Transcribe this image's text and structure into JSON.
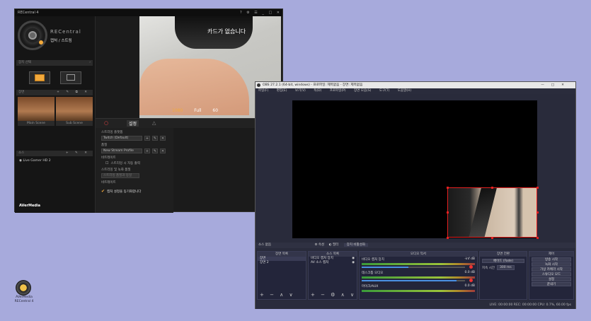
{
  "rec": {
    "title": "RECentral 4",
    "window_controls": [
      "?",
      "⚙",
      "☰",
      "_",
      "□",
      "✕"
    ],
    "brand": "RECentral",
    "mode_label": "캡처 / 스트림",
    "source_select": "장치 선택",
    "scene_section": "장면",
    "scenes": [
      {
        "label": "Main Scene"
      },
      {
        "label": "Sub Scene"
      }
    ],
    "source_section": "소스",
    "source_item": "Live Gamer HD 2",
    "preview_overlay": "카드가 없습니다",
    "preview_stats": [
      "1080",
      "Full",
      "60"
    ],
    "tabs": [
      "○",
      "설정",
      "△"
    ],
    "settings": {
      "profile_label": "스트리밍 플랫폼",
      "profile_value": "Twitch (Default)",
      "quality_label": "품질",
      "quality_value": "New Stream Profile",
      "bitrate_label": "비트레이트",
      "auto_label": "스트리밍 시 자동 출력",
      "stream_key_label": "스트리밍 및 녹화 품질",
      "key_value": "스트리밍 품질과 동일",
      "bitrate2_label": "비트레이트",
      "confirm_label": "캡처 설정을 동기화합니다"
    },
    "footer_logo": "AVerMedia"
  },
  "obs": {
    "title": "OBS 27.2.1 (64-bit, windows) - 프로파일: 제목없음 - 장면: 제목없음",
    "window_controls": [
      "—",
      "□",
      "✕"
    ],
    "menu": [
      "파일(F)",
      "편집(E)",
      "보기(V)",
      "독(D)",
      "프로파일(P)",
      "장면 모음(S)",
      "도구(T)",
      "도움말(H)"
    ],
    "source_bar": {
      "label": "소스 없음",
      "props": "⚙ 속성",
      "filters": "◐ 필터",
      "device": "장치 비활성화"
    },
    "docks": {
      "scenes": {
        "title": "장면 목록",
        "items": [
          "장면",
          "장면 2"
        ]
      },
      "sources": {
        "title": "소스 목록",
        "items": [
          "비디오 캡처 장치",
          "AV 소스 캡처"
        ]
      },
      "mixer": {
        "title": "오디오 믹서",
        "tracks": [
          {
            "name": "비디오 캡처 장치",
            "db": "-inf dB",
            "level": 0.45
          },
          {
            "name": "데스크톱 오디오",
            "db": "0.0 dB",
            "level": 0.92
          },
          {
            "name": "마이크/AUX",
            "db": "0.0 dB",
            "level": 0.92
          }
        ]
      },
      "transitions": {
        "title": "장면 전환",
        "type": "페이드 (Fade)",
        "duration_label": "지속 시간",
        "duration": "300 ms"
      },
      "controls": {
        "title": "제어",
        "buttons": [
          "방송 시작",
          "녹화 시작",
          "가상 카메라 시작",
          "스튜디오 모드",
          "설정",
          "끝내기"
        ]
      }
    },
    "status": "LIVE: 00:00:00    REC: 00:00:00    CPU: 0.7%, 60.00 fps"
  },
  "desktop_icon": {
    "label": "AVerMedia RECentral 4"
  }
}
